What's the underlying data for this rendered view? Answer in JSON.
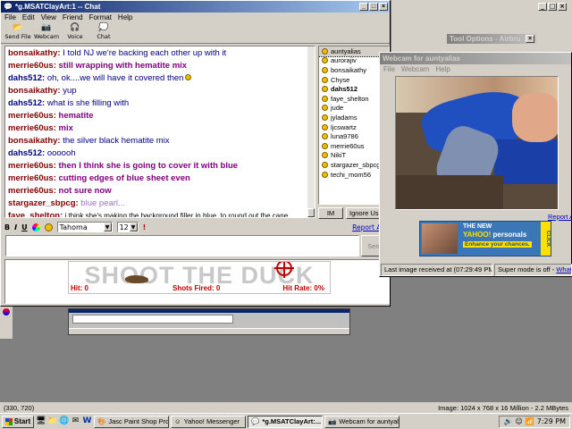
{
  "chat_window": {
    "title": "*g.MSATClayArt:1 -- Chat",
    "menu": [
      "File",
      "Edit",
      "View",
      "Friend",
      "Format",
      "Help"
    ],
    "toolbar": [
      {
        "label": "Send File",
        "icon": "send-file-icon"
      },
      {
        "label": "Webcam",
        "icon": "webcam-icon"
      },
      {
        "label": "Voice",
        "icon": "voice-icon"
      },
      {
        "label": "Chat",
        "icon": "chat-icon"
      }
    ],
    "messages": [
      {
        "nick": "bonsaikathy:",
        "text": " I told NJ we're backing each other up with it",
        "nick_color": "#800000",
        "text_color": "#000080",
        "bold_text": false
      },
      {
        "nick": "merrie60us:",
        "text": " still wrapping with hematite mix",
        "nick_color": "#800000",
        "text_color": "#800080",
        "bold_text": true
      },
      {
        "nick": "dahs512:",
        "text": " oh, ok....we will have it covered then",
        "nick_color": "#000080",
        "text_color": "#000080",
        "bold_text": false,
        "emoticon": true
      },
      {
        "nick": "bonsaikathy:",
        "text": " yup",
        "nick_color": "#800000",
        "text_color": "#000080",
        "bold_text": false
      },
      {
        "nick": "dahs512:",
        "text": " what is she filling with",
        "nick_color": "#000080",
        "text_color": "#000080",
        "bold_text": false
      },
      {
        "nick": "merrie60us:",
        "text": " hematite",
        "nick_color": "#800000",
        "text_color": "#800080",
        "bold_text": true
      },
      {
        "nick": "merrie60us:",
        "text": " mix",
        "nick_color": "#800000",
        "text_color": "#800080",
        "bold_text": true
      },
      {
        "nick": "bonsaikathy:",
        "text": " the silver black hematite mix",
        "nick_color": "#800000",
        "text_color": "#000080",
        "bold_text": false
      },
      {
        "nick": "dahs512:",
        "text": " oooooh",
        "nick_color": "#000080",
        "text_color": "#000080",
        "bold_text": false
      },
      {
        "nick": "merrie60us:",
        "text": " then I think she is going to cover it with blue",
        "nick_color": "#800000",
        "text_color": "#800080",
        "bold_text": true
      },
      {
        "nick": "merrie60us:",
        "text": " cutting edges of blue sheet even",
        "nick_color": "#800000",
        "text_color": "#800080",
        "bold_text": true
      },
      {
        "nick": "merrie60us:",
        "text": " not sure now",
        "nick_color": "#800000",
        "text_color": "#800080",
        "bold_text": true
      },
      {
        "nick": "stargazer_sbpcg:",
        "text": " blue pearl...",
        "nick_color": "#800000",
        "text_color": "#a070c0",
        "bold_text": false
      },
      {
        "nick": "faye_shelton:",
        "text": " i think she's making the background filler in blue, to round out the cane",
        "nick_color": "#800000",
        "text_color": "#000000",
        "bold_text": false,
        "small_text": true
      }
    ],
    "users": [
      "auntyalias",
      "aurorajiv",
      "bonsaikathy",
      "Chyse",
      "dahs512",
      "faye_shelton",
      "jude",
      "jyladams",
      "ljcswartz",
      "luna9786",
      "merrie60us",
      "NikiT",
      "stargazer_sbpcg",
      "techi_mom56"
    ],
    "im_button": "IM",
    "ignore_button": "Ignore Us",
    "font_name": "Tahoma",
    "font_size": "12",
    "report_abuse": "Report Abu",
    "send_label": "Send",
    "format_buttons": [
      "B",
      "I",
      "U"
    ]
  },
  "game_ad": {
    "title": "SHOOT THE DUCK",
    "hit": "Hit: 0",
    "shots": "Shots Fired: 0",
    "rate": "Hit Rate: 0%"
  },
  "webcam_window": {
    "title": "Webcam for auntyalias",
    "menu": [
      "File",
      "Webcam",
      "Help"
    ],
    "report_abuse": "Report Ab",
    "ad": {
      "line1": "THE NEW",
      "brand": "YAHOO!",
      "line2": "personals",
      "line3": "Enhance your chances.",
      "cta": "CLICK"
    },
    "status_left": "Last image received at (07:29:49 PM)",
    "status_mid": "Super mode is off -",
    "status_link": "What's t"
  },
  "background_app": {
    "tool_options": "Tool Options - Airbru"
  },
  "app_status": {
    "coords": "(330, 720)",
    "image_info": "Image:  1024 x 768 x 16 Million - 2.2 MBytes"
  },
  "taskbar": {
    "start": "Start",
    "tasks": [
      {
        "label": "Jasc Paint Shop Pro -...",
        "active": false
      },
      {
        "label": "Yahoo! Messenger",
        "active": false
      },
      {
        "label": "*g.MSATClayArt:...",
        "active": true
      },
      {
        "label": "Webcam for auntyalias",
        "active": false
      }
    ],
    "clock": "7:29 PM"
  }
}
